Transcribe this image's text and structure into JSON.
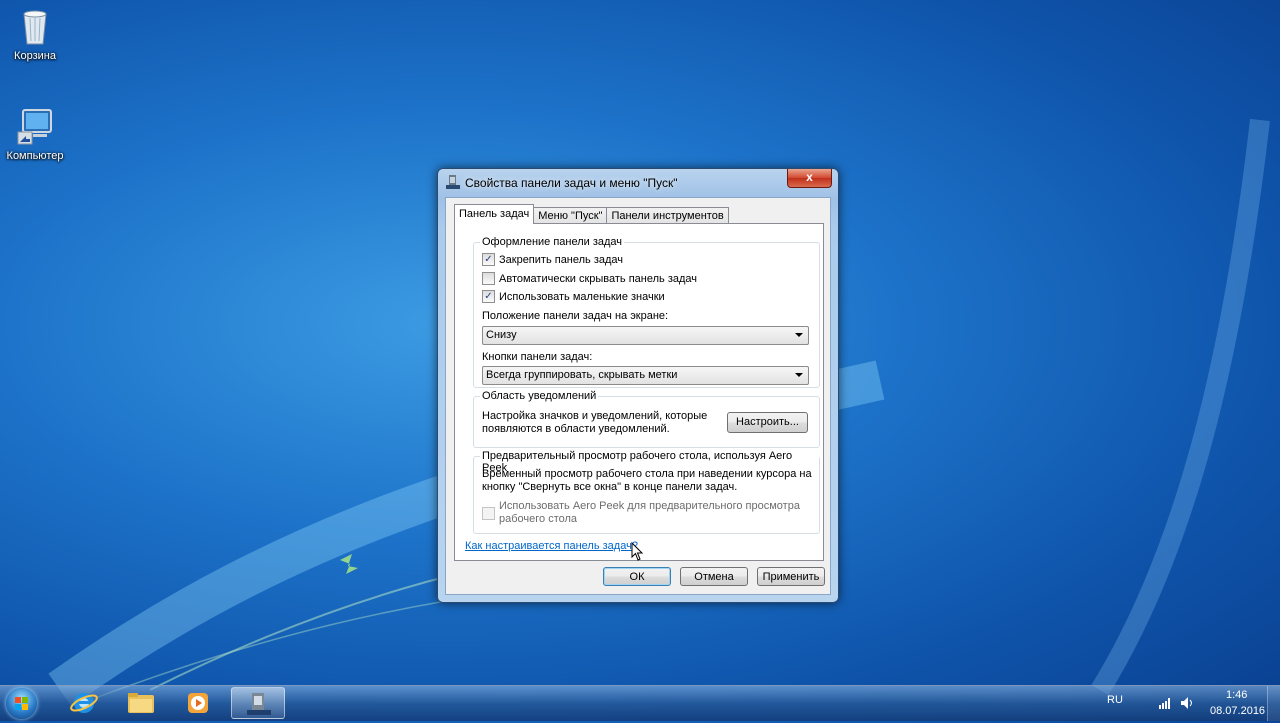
{
  "desktop": {
    "icons": [
      {
        "label": "Корзина",
        "icon": "recycle-bin-icon"
      },
      {
        "label": "Компьютер",
        "icon": "computer-icon"
      }
    ]
  },
  "window": {
    "title": "Свойства панели задач и меню \"Пуск\"",
    "close_label": "x",
    "tabs": [
      {
        "label": "Панель задач",
        "active": true
      },
      {
        "label": "Меню \"Пуск\"",
        "active": false
      },
      {
        "label": "Панели инструментов",
        "active": false
      }
    ],
    "appearance": {
      "title": "Оформление панели задач",
      "checkboxes": [
        {
          "label": "Закрепить панель задач",
          "checked": true
        },
        {
          "label": "Автоматически скрывать панель задач",
          "checked": false
        },
        {
          "label": "Использовать маленькие значки",
          "checked": true
        }
      ],
      "position_label": "Положение панели задач на экране:",
      "position_value": "Снизу",
      "buttons_label": "Кнопки панели задач:",
      "buttons_value": "Всегда группировать, скрывать метки"
    },
    "notifications": {
      "title": "Область уведомлений",
      "text_line1": "Настройка значков и уведомлений, которые",
      "text_line2": "появляются в области уведомлений.",
      "customize_button": "Настроить..."
    },
    "aero_peek": {
      "title": "Предварительный просмотр рабочего стола, используя Aero Peek",
      "text_line1": "Временный просмотр рабочего стола при наведении курсора на",
      "text_line2": "кнопку \"Свернуть все окна\" в конце панели задач.",
      "checkbox_line1": "Использовать Aero Peek для предварительного просмотра",
      "checkbox_line2": "рабочего стола",
      "checked": false
    },
    "help_link": "Как настраивается панель задач?",
    "buttons": {
      "ok": "ОК",
      "cancel": "Отмена",
      "apply": "Применить"
    }
  },
  "taskbar": {
    "items": [
      "start-orb-icon",
      "internet-explorer-icon",
      "file-explorer-icon",
      "media-player-icon",
      "taskbar-properties-icon"
    ],
    "language": "RU",
    "time": "1:46",
    "date": "08.07.2016"
  },
  "colors": {
    "desktop_blue": "#1d73c9",
    "link": "#0066cc",
    "close_red": "#c2301a"
  }
}
